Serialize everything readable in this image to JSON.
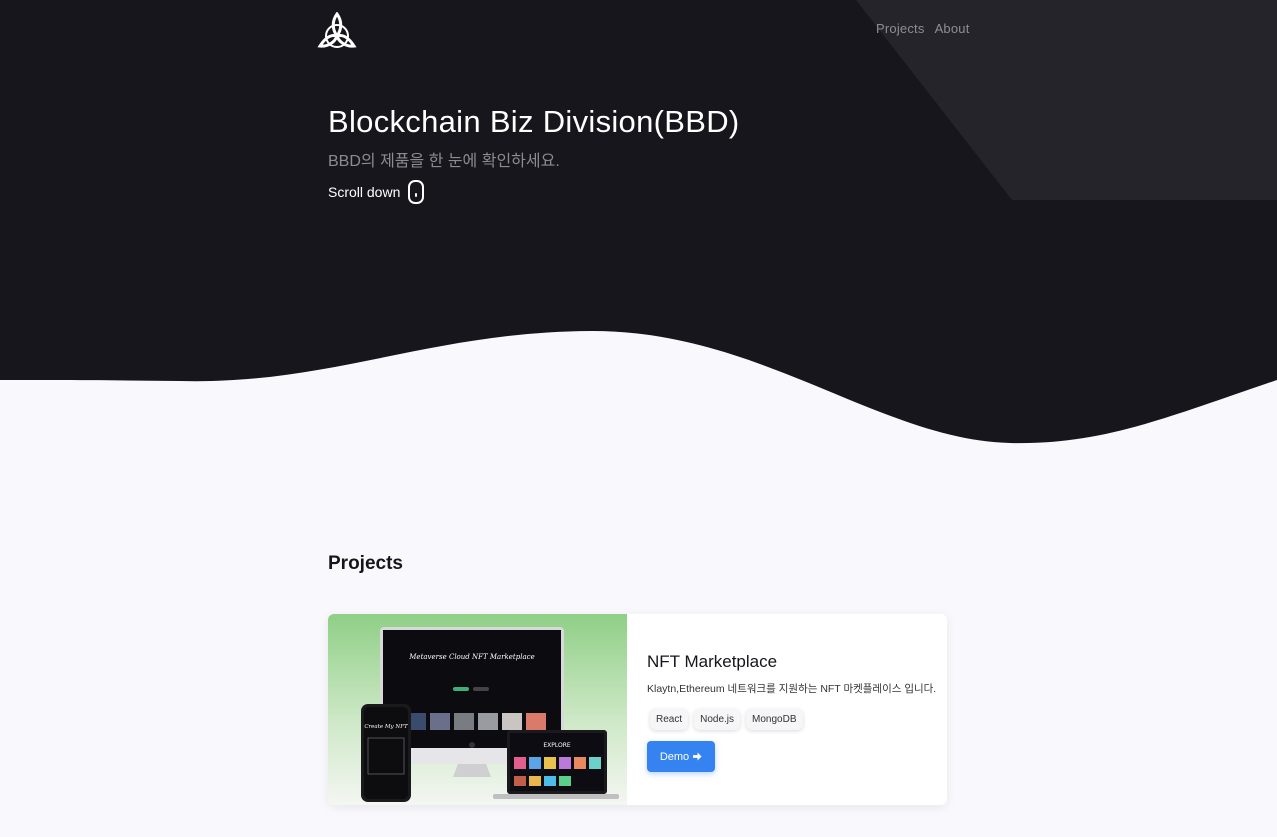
{
  "colors": {
    "hero_bg": "#17161c",
    "hero_accent": "#25242a",
    "page_bg": "#f9f9fd",
    "primary": "#3483f1"
  },
  "nav": {
    "logo_icon": "triquetra-logo-icon",
    "items": [
      "Projects",
      "About"
    ]
  },
  "hero": {
    "title": "Blockchain Biz Division(BBD)",
    "subtitle": "BBD의 제품을 한 눈에 확인하세요.",
    "scroll_label": "Scroll down",
    "scroll_icon": "mouse-icon"
  },
  "projects": {
    "heading": "Projects",
    "items": [
      {
        "image_caption": "Metaverse Cloud NFT Marketplace",
        "image_phone_caption": "Create My NFT",
        "image_laptop_caption": "EXPLORE",
        "title": "NFT Marketplace",
        "description": "Klaytn,Ethereum 네트워크를 지원하는 NFT 마켓플레이스 입니다.",
        "tags": [
          "React",
          "Node.js",
          "MongoDB"
        ],
        "demo_label": "Demo",
        "demo_icon": "arrow-right-icon"
      }
    ]
  }
}
